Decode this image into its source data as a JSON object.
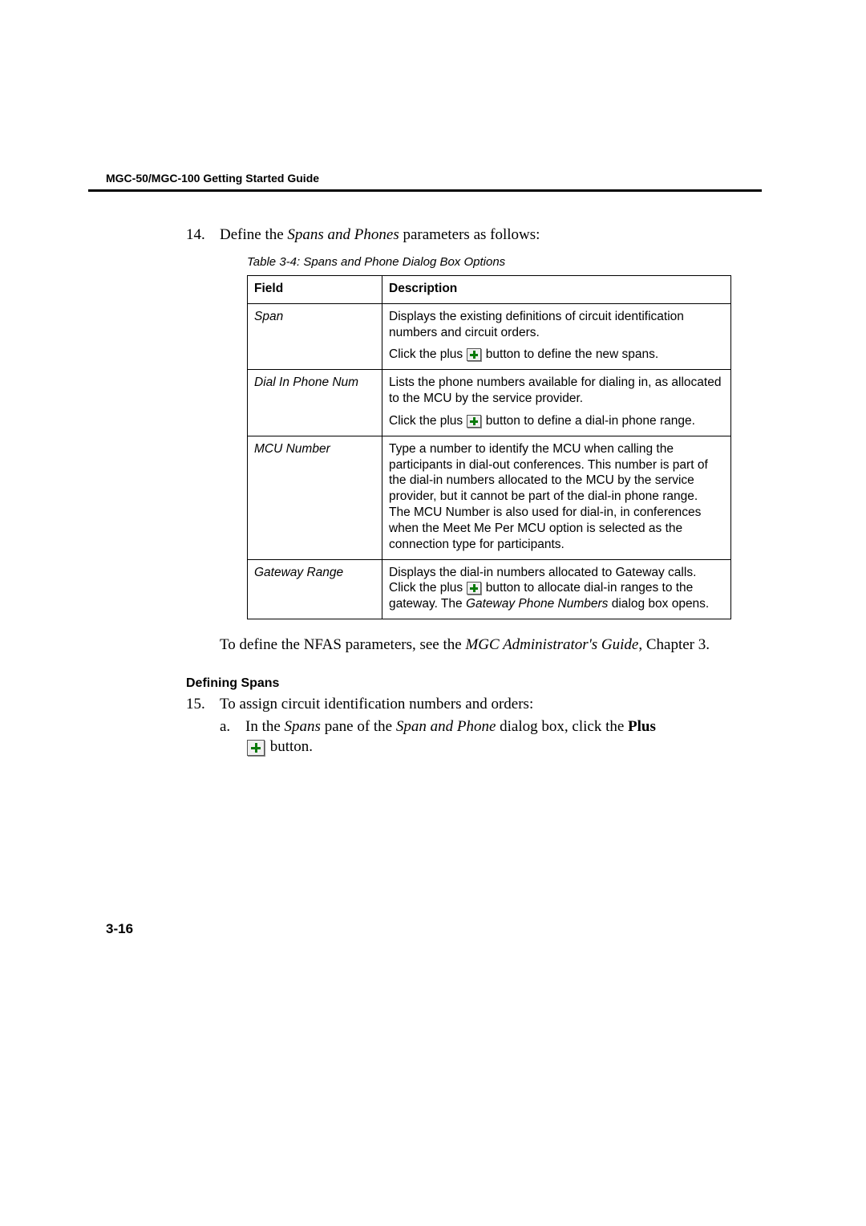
{
  "header": {
    "title": "MGC-50/MGC-100 Getting Started Guide"
  },
  "step14": {
    "number": "14.",
    "text_before": "Define the ",
    "text_italic": "Spans and Phones",
    "text_after": " parameters as follows:"
  },
  "table": {
    "caption": "Table 3-4: Spans and Phone Dialog Box Options",
    "head_field": "Field",
    "head_desc": "Description",
    "rows": [
      {
        "field": "Span",
        "desc1": "Displays the existing definitions of circuit identification numbers and circuit orders.",
        "desc2a": "Click the plus ",
        "desc2b": " button to define the new spans."
      },
      {
        "field": "Dial In Phone Num",
        "desc1": "Lists the phone numbers available for dialing in, as allocated to the MCU by the service provider.",
        "desc2a": "Click the plus ",
        "desc2b": " button to define a dial-in phone range."
      },
      {
        "field": "MCU Number",
        "desc1": "Type a number to identify the MCU when calling the participants in dial-out conferences. This number is part of the dial-in numbers allocated to the MCU by the service provider, but it cannot be part of the dial-in phone range.",
        "desc2": "The MCU Number is also used for dial-in, in conferences when the Meet Me Per MCU option is selected as the connection type for participants."
      },
      {
        "field": "Gateway Range",
        "desc1a": "Displays the dial-in numbers allocated to Gateway calls. Click the plus ",
        "desc1b": " button to allocate dial-in ranges to the gateway. The ",
        "desc1_italic": "Gateway Phone Numbers",
        "desc1c": " dialog box opens."
      }
    ]
  },
  "post_table": {
    "t1": "To define the NFAS parameters, see the ",
    "t_italic": "MGC Administrator's Guide",
    "t2": ", Chapter 3."
  },
  "subheading": "Defining Spans",
  "step15": {
    "number": "15.",
    "text": "To assign circuit identification numbers and orders:"
  },
  "step15a": {
    "letter": "a.",
    "t1": "In the ",
    "i1": "Spans",
    "t2": " pane of the ",
    "i2": "Span and Phone",
    "t3": " dialog box, click the ",
    "b1": "Plus",
    "t4": " button."
  },
  "page_number": "3-16"
}
